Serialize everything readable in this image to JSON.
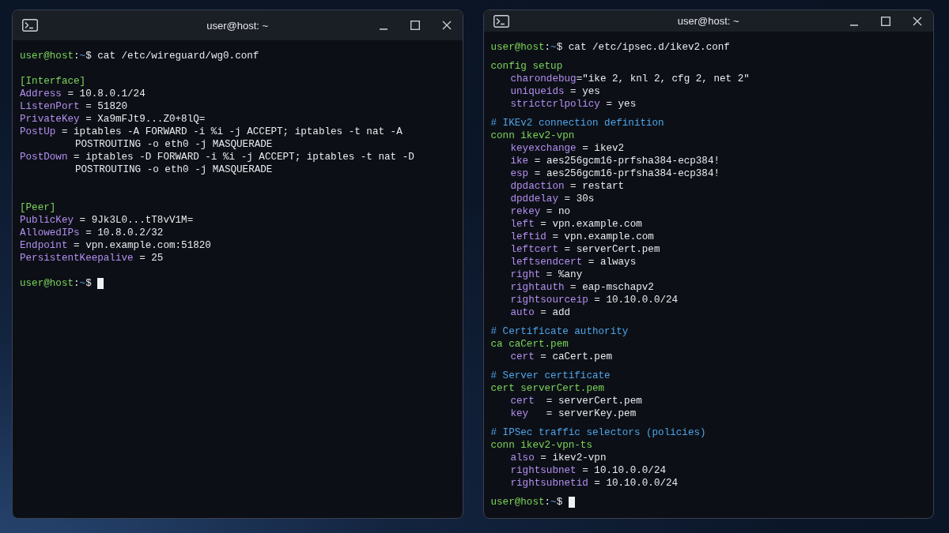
{
  "windows": [
    {
      "title": "user@host: ~",
      "lines": [
        {
          "kind": "prompt",
          "user": "user@host",
          "sep": ":",
          "path": "~",
          "symbol": "$",
          "command": "cat /etc/wireguard/wg0.conf",
          "cursor": false
        },
        {
          "kind": "blank"
        },
        {
          "kind": "section",
          "text": "[Interface]"
        },
        {
          "kind": "kv",
          "key": "Address",
          "sep": " = ",
          "value": "10.8.0.1/24"
        },
        {
          "kind": "kv",
          "key": "ListenPort",
          "sep": " = ",
          "value": "51820"
        },
        {
          "kind": "kv",
          "key": "PrivateKey",
          "sep": " = ",
          "value": "Xa9mFJt9...Z0+8lQ="
        },
        {
          "kind": "kv",
          "key": "PostUp",
          "sep": " = ",
          "value": "iptables -A FORWARD -i %i -j ACCEPT; iptables -t nat -A"
        },
        {
          "kind": "cont",
          "text": "POSTROUTING -o eth0 -j MASQUERADE"
        },
        {
          "kind": "kv",
          "key": "PostDown",
          "sep": " = ",
          "value": "iptables -D FORWARD -i %i -j ACCEPT; iptables -t nat -D"
        },
        {
          "kind": "cont",
          "text": "POSTROUTING -o eth0 -j MASQUERADE"
        },
        {
          "kind": "blank"
        },
        {
          "kind": "blank"
        },
        {
          "kind": "section",
          "text": "[Peer]"
        },
        {
          "kind": "kv",
          "key": "PublicKey",
          "sep": " = ",
          "value": "9Jk3L0...tT8vV1M="
        },
        {
          "kind": "kv",
          "key": "AllowedIPs",
          "sep": " = ",
          "value": "10.8.0.2/32"
        },
        {
          "kind": "kv",
          "key": "Endpoint",
          "sep": " = ",
          "value": "vpn.example.com:51820"
        },
        {
          "kind": "kv",
          "key": "PersistentKeepalive",
          "sep": " = ",
          "value": "25"
        },
        {
          "kind": "blank"
        },
        {
          "kind": "prompt",
          "user": "user@host",
          "sep": ":",
          "path": "~",
          "symbol": "$",
          "cursor": true
        }
      ]
    },
    {
      "title": "user@host: ~",
      "lines": [
        {
          "kind": "prompt",
          "user": "user@host",
          "sep": ":",
          "path": "~",
          "symbol": "$",
          "command": "cat /etc/ipsec.d/ikev2.conf",
          "cursor": false
        },
        {
          "kind": "gap"
        },
        {
          "kind": "section",
          "text": "config setup"
        },
        {
          "kind": "setting",
          "key": "charondebug",
          "sep": "=",
          "value": "\"ike 2, knl 2, cfg 2, net 2\""
        },
        {
          "kind": "setting",
          "key": "uniqueids",
          "sep": " = ",
          "value": "yes"
        },
        {
          "kind": "setting",
          "key": "strictcrlpolicy",
          "sep": " = ",
          "value": "yes"
        },
        {
          "kind": "gap"
        },
        {
          "kind": "comment",
          "text": "# IKEv2 connection definition"
        },
        {
          "kind": "section",
          "text": "conn ikev2-vpn"
        },
        {
          "kind": "setting",
          "key": "keyexchange",
          "sep": " = ",
          "value": "ikev2"
        },
        {
          "kind": "setting",
          "key": "ike",
          "sep": " = ",
          "value": "aes256gcm16-prfsha384-ecp384!"
        },
        {
          "kind": "setting",
          "key": "esp",
          "sep": " = ",
          "value": "aes256gcm16-prfsha384-ecp384!"
        },
        {
          "kind": "setting",
          "key": "dpdaction",
          "sep": " = ",
          "value": "restart"
        },
        {
          "kind": "setting",
          "key": "dpddelay",
          "sep": " = ",
          "value": "30s"
        },
        {
          "kind": "setting",
          "key": "rekey",
          "sep": " = ",
          "value": "no"
        },
        {
          "kind": "setting",
          "key": "left",
          "sep": " = ",
          "value": "vpn.example.com"
        },
        {
          "kind": "setting",
          "key": "leftid",
          "sep": " = ",
          "value": "vpn.example.com"
        },
        {
          "kind": "setting",
          "key": "leftcert",
          "sep": " = ",
          "value": "serverCert.pem"
        },
        {
          "kind": "setting",
          "key": "leftsendcert",
          "sep": " = ",
          "value": "always"
        },
        {
          "kind": "setting",
          "key": "right",
          "sep": " = ",
          "value": "%any"
        },
        {
          "kind": "setting",
          "key": "rightauth",
          "sep": " = ",
          "value": "eap-mschapv2"
        },
        {
          "kind": "setting",
          "key": "rightsourceip",
          "sep": " = ",
          "value": "10.10.0.0/24"
        },
        {
          "kind": "setting",
          "key": "auto",
          "sep": " = ",
          "value": "add"
        },
        {
          "kind": "gap"
        },
        {
          "kind": "comment",
          "text": "# Certificate authority"
        },
        {
          "kind": "section",
          "text": "ca caCert.pem"
        },
        {
          "kind": "setting",
          "key": "cert",
          "sep": " = ",
          "value": "caCert.pem"
        },
        {
          "kind": "gap"
        },
        {
          "kind": "comment",
          "text": "# Server certificate"
        },
        {
          "kind": "section",
          "text": "cert serverCert.pem"
        },
        {
          "kind": "setting",
          "key": "cert",
          "sep": "  = ",
          "value": "serverCert.pem"
        },
        {
          "kind": "setting",
          "key": "key",
          "sep": "   = ",
          "value": "serverKey.pem"
        },
        {
          "kind": "gap"
        },
        {
          "kind": "comment",
          "text": "# IPSec traffic selectors (policies)"
        },
        {
          "kind": "section",
          "text": "conn ikev2-vpn-ts"
        },
        {
          "kind": "setting",
          "key": "also",
          "sep": " = ",
          "value": "ikev2-vpn"
        },
        {
          "kind": "setting",
          "key": "rightsubnet",
          "sep": " = ",
          "value": "10.10.0.0/24"
        },
        {
          "kind": "setting",
          "key": "rightsubnetid",
          "sep": " = ",
          "value": "10.10.0.0/24"
        },
        {
          "kind": "gap"
        },
        {
          "kind": "prompt",
          "user": "user@host",
          "sep": ":",
          "path": "~",
          "symbol": "$",
          "cursor": true
        }
      ]
    }
  ]
}
